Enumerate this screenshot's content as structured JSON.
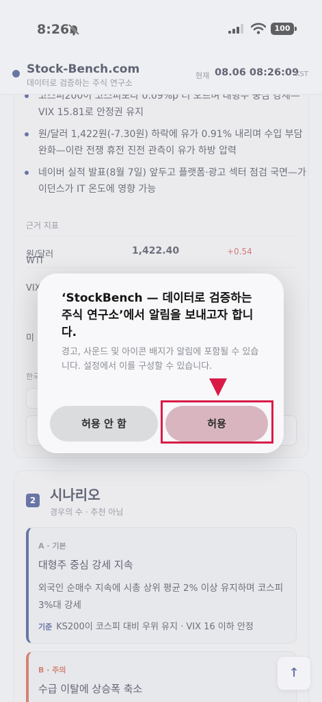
{
  "status_bar": {
    "time": "8:26",
    "battery": "100"
  },
  "header": {
    "brand": "Stock-Bench.com",
    "subtitle": "데이터로 검증하는 주식 연구소",
    "now_label": "현재",
    "now_time": "08.06 08:26:09",
    "tz": "KST"
  },
  "briefing": {
    "bullets": [
      "코스피200이 코스피보다 0.09%p 더 오르며 대형주 중심 강세—VIX 15.81로 안정권 유지",
      "원/달러 1,422원(-7.30원) 하락에 유가 0.91% 내리며 수입 부담 완화—이란 전쟁 휴전 진전 관측이 유가 하방 압력",
      "네이버 실적 발표(8월 7일) 앞두고 플랫폼·광고 섹터 점검 국면—가이던스가 IT 온도에 영향 가능"
    ],
    "metrics_title": "근거 지표",
    "metrics": [
      {
        "name": "원/달러",
        "value": "1,422.40",
        "change": "+0.54"
      },
      {
        "name": "WTI",
        "value": "",
        "change": ""
      },
      {
        "name": "VIX",
        "value": "",
        "change": ""
      },
      {
        "name": "미",
        "value": "",
        "change": ""
      }
    ],
    "footer": "한국"
  },
  "scenarios": {
    "number": "2",
    "title": "시나리오",
    "subtitle": "경우의 수 · 추천 아님",
    "items": [
      {
        "tag": "A · 기본",
        "title": "대형주 중심 강세 지속",
        "desc": "외국인 순매수 지속에 시총 상위 평균 2% 이상 유지하며 코스피 3%대 강세",
        "basis_label": "기준",
        "basis": "KS200이 코스피 대비 우위 유지 · VIX 16 이하 안정"
      },
      {
        "tag": "B · 주의",
        "title": "수급 이탈에 상승폭 축소"
      }
    ]
  },
  "scroll_top": "↑",
  "dialog": {
    "title": "‘StockBench — 데이터로 검증하는 주식 연구소’에서 알림을 보내고자 합니다.",
    "message": "경고, 사운드 및 아이콘 배지가 알림에 포함될 수 있습니다. 설정에서 이를 구성할 수 있습니다.",
    "deny_label": "허용 안 함",
    "allow_label": "허용"
  },
  "colors": {
    "brand": "#20337a",
    "highlight": "#d81b47",
    "positive_change": "#c23b3b"
  }
}
